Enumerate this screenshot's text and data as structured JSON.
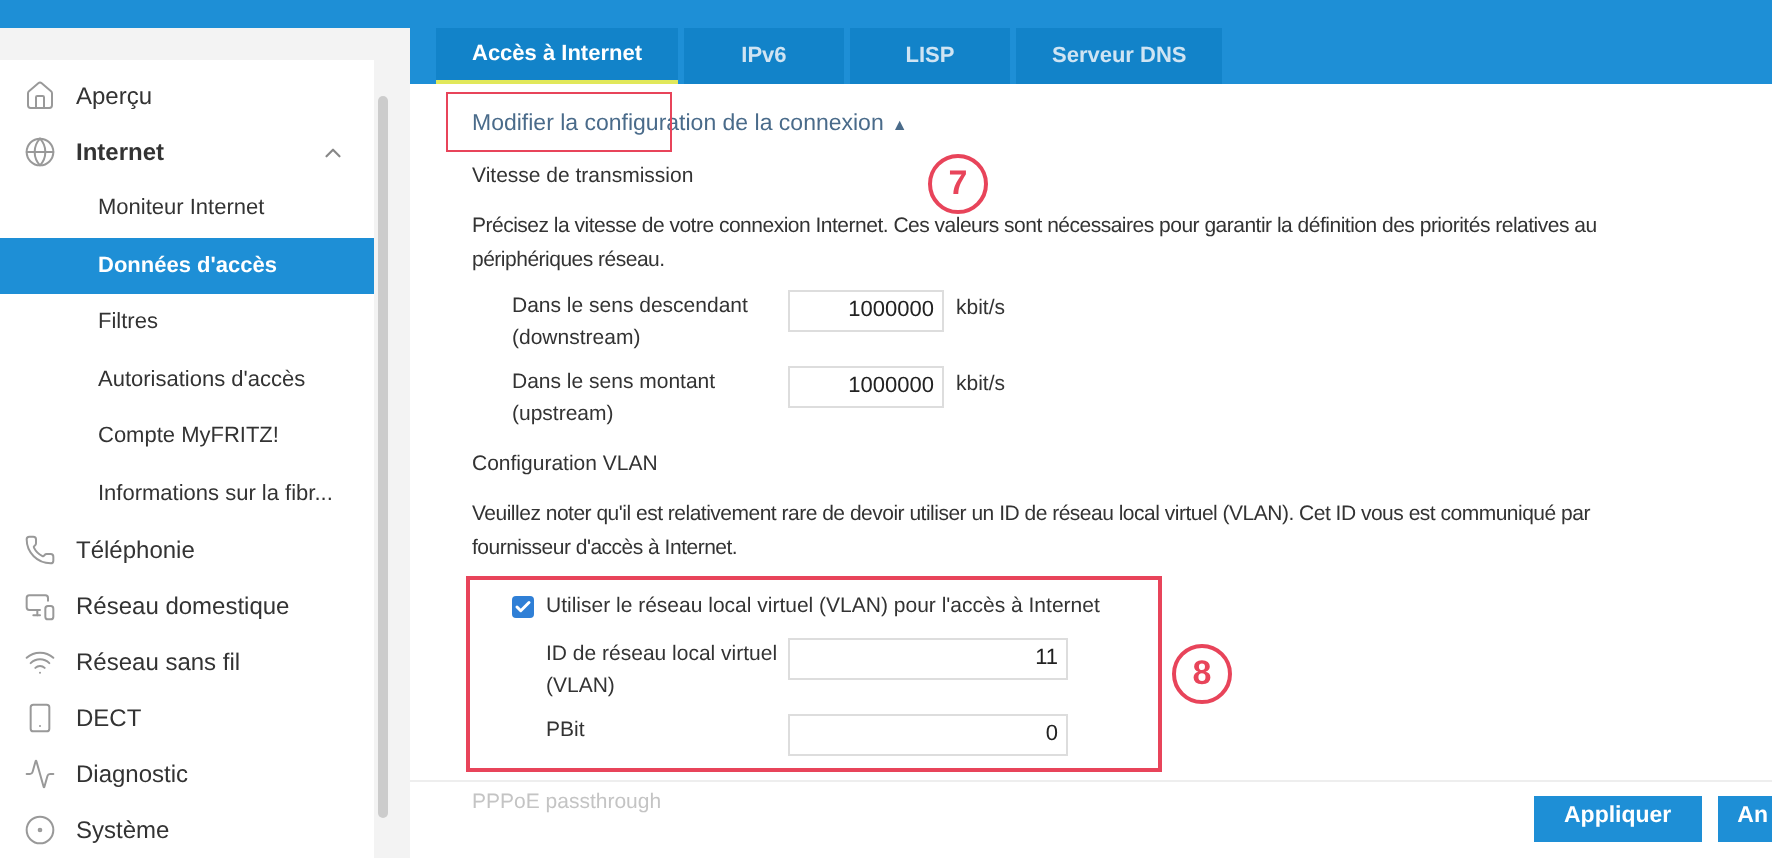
{
  "sidebar": {
    "items": [
      {
        "label": "Aperçu",
        "selected": false
      },
      {
        "label": "Internet",
        "selected": false,
        "expanded": true,
        "children": [
          {
            "label": "Moniteur Internet",
            "selected": false
          },
          {
            "label": "Données d'accès",
            "selected": true
          },
          {
            "label": "Filtres",
            "selected": false
          },
          {
            "label": "Autorisations d'accès",
            "selected": false
          },
          {
            "label": "Compte MyFRITZ!",
            "selected": false
          },
          {
            "label": "Informations sur la fibr...",
            "selected": false
          }
        ]
      },
      {
        "label": "Téléphonie",
        "selected": false
      },
      {
        "label": "Réseau domestique",
        "selected": false
      },
      {
        "label": "Réseau sans fil",
        "selected": false
      },
      {
        "label": "DECT",
        "selected": false
      },
      {
        "label": "Diagnostic",
        "selected": false
      },
      {
        "label": "Système",
        "selected": false
      }
    ]
  },
  "tabs": [
    {
      "label": "Accès à Internet",
      "selected": true
    },
    {
      "label": "IPv6",
      "selected": false
    },
    {
      "label": "LISP",
      "selected": false
    },
    {
      "label": "Serveur DNS",
      "selected": false
    }
  ],
  "toggle_link": {
    "label": "Modifier la configuration de la connexion",
    "glyph": "▲"
  },
  "speed": {
    "heading": "Vitesse de transmission",
    "text": "Précisez la vitesse de votre connexion Internet. Ces valeurs sont nécessaires pour garantir la définition des priorités relatives au",
    "text_2": "périphériques réseau.",
    "fields": [
      {
        "label": "Dans le sens descendant (downstream)",
        "value": "1000000",
        "unit": "kbit/s"
      },
      {
        "label": "Dans le sens montant (upstream)",
        "value": "1000000",
        "unit": "kbit/s"
      }
    ]
  },
  "vlan": {
    "heading": "Configuration VLAN",
    "text": "Veuillez noter qu'il est relativement rare de devoir utiliser un ID de réseau local virtuel (VLAN). Cet ID vous est communiqué par",
    "text_2": "fournisseur d'accès à Internet.",
    "checkbox": {
      "label": "Utiliser le réseau local virtuel (VLAN) pour l'accès à Internet",
      "checked": true
    },
    "fields": [
      {
        "label": "ID de réseau local virtuel (VLAN)",
        "value": "11"
      },
      {
        "label": "PBit",
        "value": "0"
      }
    ]
  },
  "pppoe": {
    "heading": "PPPoE passthrough",
    "disabled": true
  },
  "buttons": [
    "Appliquer",
    "An"
  ],
  "annotations": [
    "7",
    "8"
  ]
}
